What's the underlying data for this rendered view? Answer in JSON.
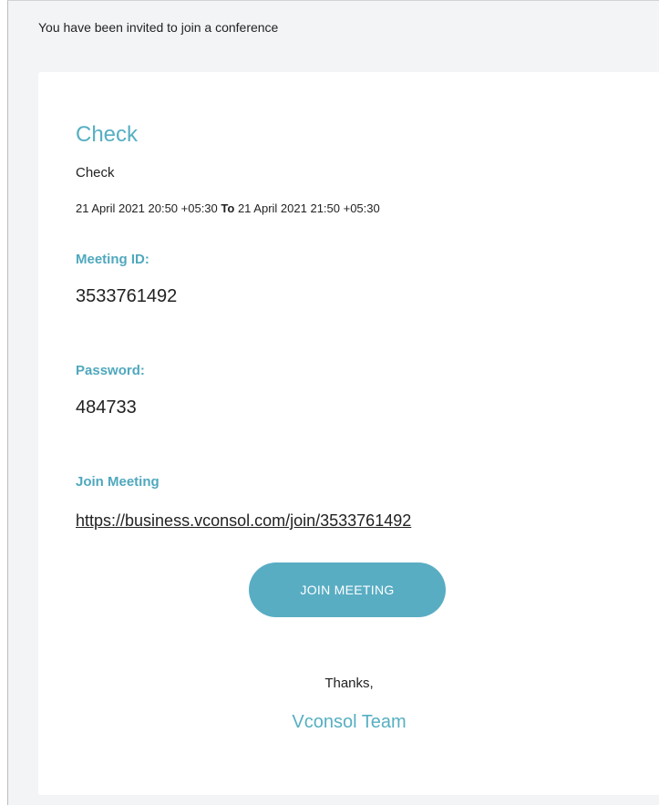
{
  "email": {
    "intro": "You have been invited to join a conference",
    "title": "Check",
    "subject": "Check",
    "start": "21 April 2021 20:50 +05:30",
    "separator": "To",
    "end": "21 April 2021 21:50 +05:30",
    "meeting_id_label": "Meeting ID:",
    "meeting_id": "3533761492",
    "password_label": "Password:",
    "password": "484733",
    "join_label": "Join Meeting",
    "join_url": "https://business.vconsol.com/join/3533761492",
    "join_button": "JOIN MEETING",
    "thanks": "Thanks,",
    "team": "Vconsol Team"
  },
  "colors": {
    "accent": "#56afc2",
    "button": "#59adc3",
    "background": "#f3f4f6",
    "card": "#ffffff",
    "text": "#222222"
  }
}
